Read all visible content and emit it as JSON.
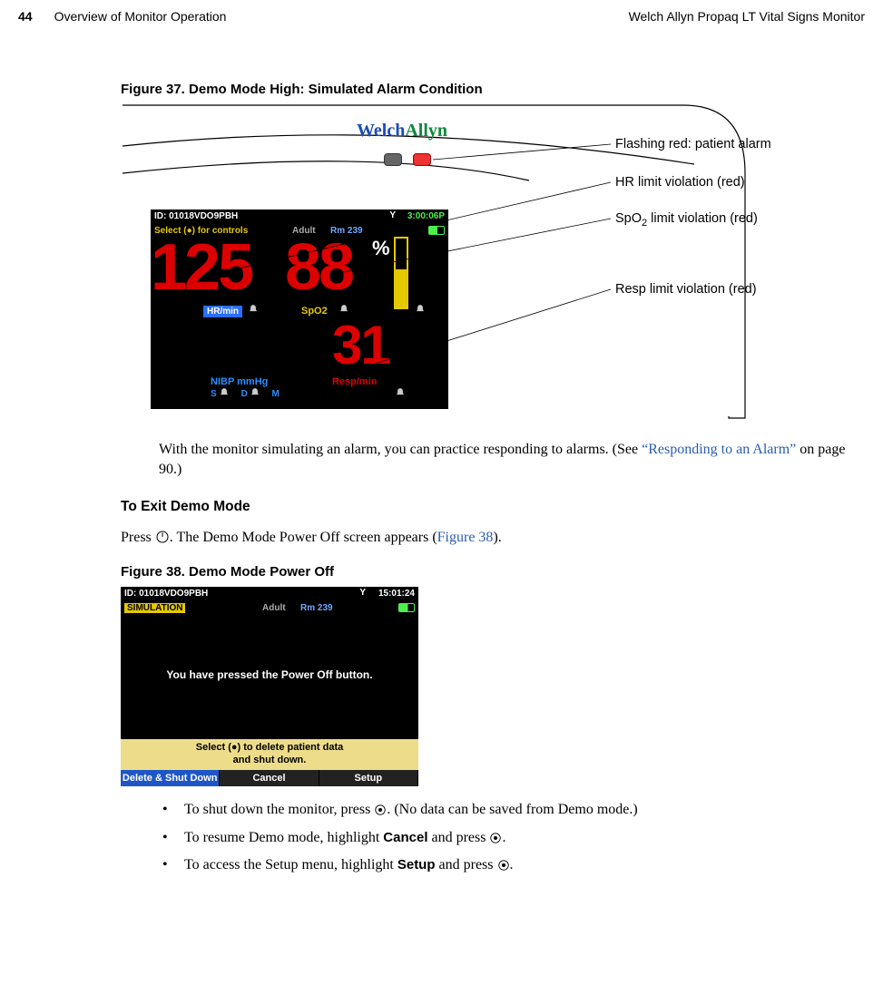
{
  "header": {
    "page_number": "44",
    "section": "Overview of Monitor Operation",
    "product": "Welch Allyn Propaq LT Vital Signs Monitor"
  },
  "figure37": {
    "caption": "Figure 37.  Demo Mode High: Simulated Alarm Condition",
    "brand_w": "Welch",
    "brand_a": "Allyn",
    "screen": {
      "id": "ID: 01018VDO9PBH",
      "time": "3:00:06P",
      "select_hint": "Select (●) for controls",
      "adult": "Adult",
      "room": "Rm 239",
      "hr_value": "125",
      "hr_label": "HR/min",
      "spo2_value": "88",
      "spo2_label": "SpO2",
      "percent": "%",
      "resp_value": "31",
      "resp_label": "Resp/min",
      "nibp_label": "NIBP mmHg",
      "sdm": "S  D  M"
    },
    "callouts": {
      "flash": "Flashing red: patient alarm",
      "hr": "HR limit violation (red)",
      "spo2_pre": "SpO",
      "spo2_sub": "2",
      "spo2_post": " limit violation (red)",
      "resp": "Resp limit violation (red)"
    }
  },
  "para1_a": "With the monitor simulating an alarm, you can practice responding to alarms. (See ",
  "para1_link": "“Responding to an Alarm”",
  "para1_b": " on page 90.)",
  "exit_title": "To Exit Demo Mode",
  "exit_p_a": "Press ",
  "exit_p_b": ". The Demo Mode Power Off screen appears (",
  "exit_p_link": "Figure 38",
  "exit_p_c": ").",
  "figure38": {
    "caption": "Figure 38.  Demo Mode Power Off",
    "screen": {
      "id": "ID: 01018VDO9PBH",
      "time": "15:01:24",
      "simulation": "SIMULATION",
      "adult": "Adult",
      "room": "Rm 239",
      "message": "You have pressed the Power Off button.",
      "yellow_line1": "Select (●) to delete patient data",
      "yellow_line2": "and shut down.",
      "softkey_delete": "Delete & Shut Down",
      "softkey_cancel": "Cancel",
      "softkey_setup": "Setup"
    }
  },
  "bullets": {
    "b1_a": "To shut down the monitor, press ",
    "b1_b": ". (No data can be saved from Demo mode.)",
    "b2_a": "To resume Demo mode, highlight ",
    "b2_bold": "Cancel",
    "b2_b": " and press ",
    "b2_c": ".",
    "b3_a": "To access the Setup menu, highlight ",
    "b3_bold": "Setup",
    "b3_b": " and press ",
    "b3_c": "."
  }
}
